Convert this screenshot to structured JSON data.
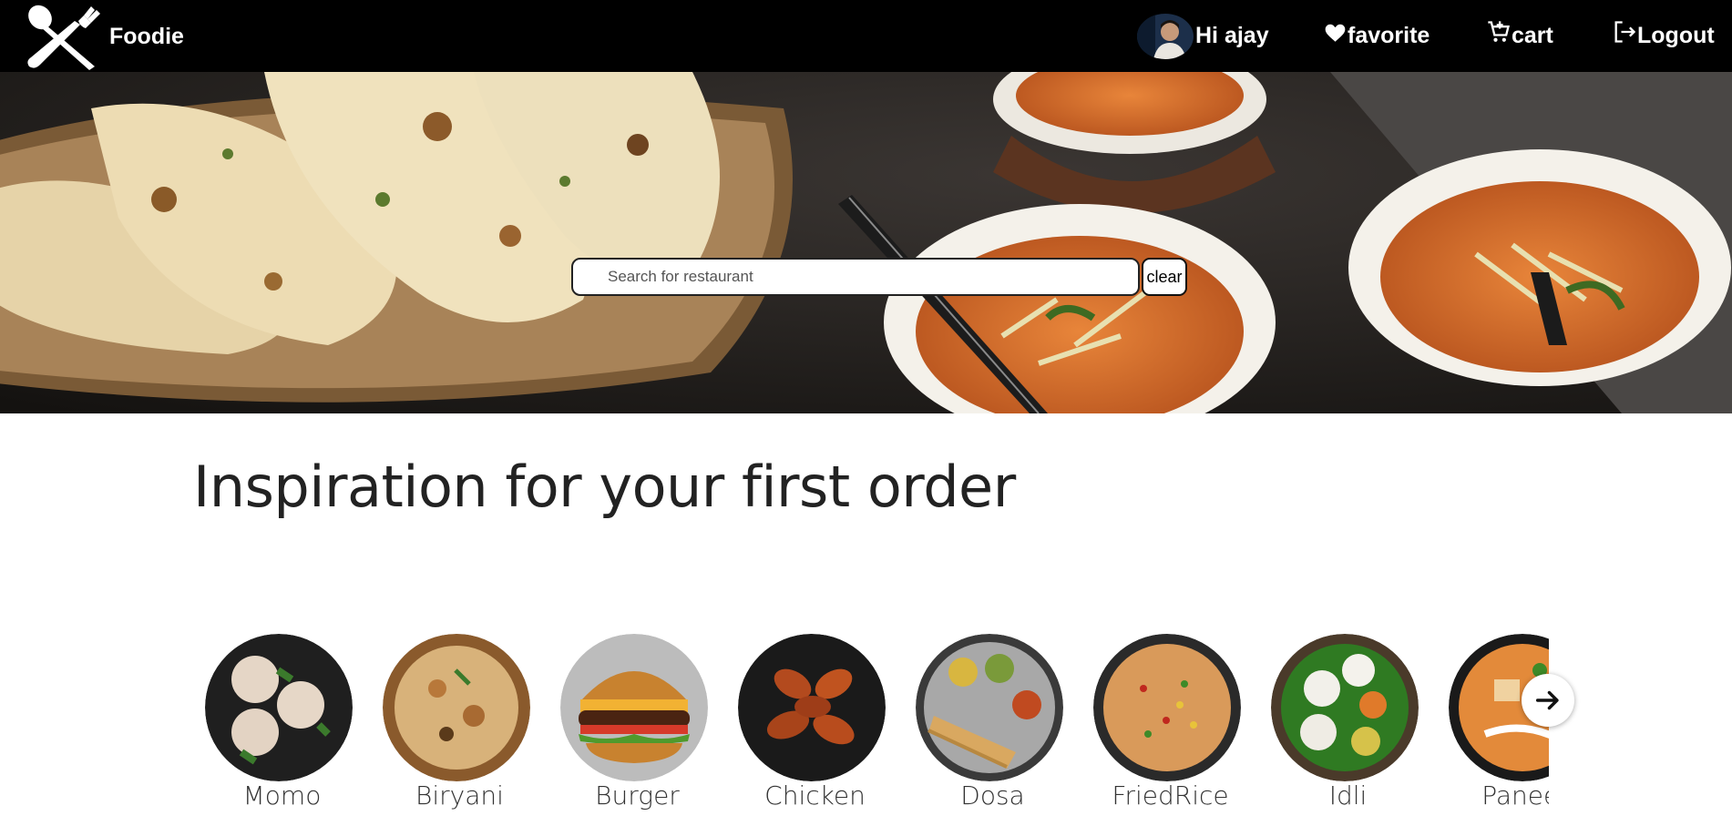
{
  "brand": {
    "name": "Foodie",
    "logo_icon": "fork-spoon-crossed-icon"
  },
  "nav": {
    "greeting": "Hi ajay",
    "favorite_label": "favorite",
    "cart_label": "cart",
    "logout_label": "Logout"
  },
  "search": {
    "placeholder": "Search for restaurant",
    "value": "",
    "clear_label": "clear"
  },
  "section": {
    "title": "Inspiration for your first order"
  },
  "categories": [
    {
      "label": "Momo"
    },
    {
      "label": "Biryani"
    },
    {
      "label": "Burger"
    },
    {
      "label": "Chicken"
    },
    {
      "label": "Dosa"
    },
    {
      "label": "FriedRice"
    },
    {
      "label": "Idli"
    },
    {
      "label": "Paneer"
    }
  ],
  "colors": {
    "navbar": "#000000",
    "accent_white": "#ffffff",
    "text": "#222222"
  }
}
